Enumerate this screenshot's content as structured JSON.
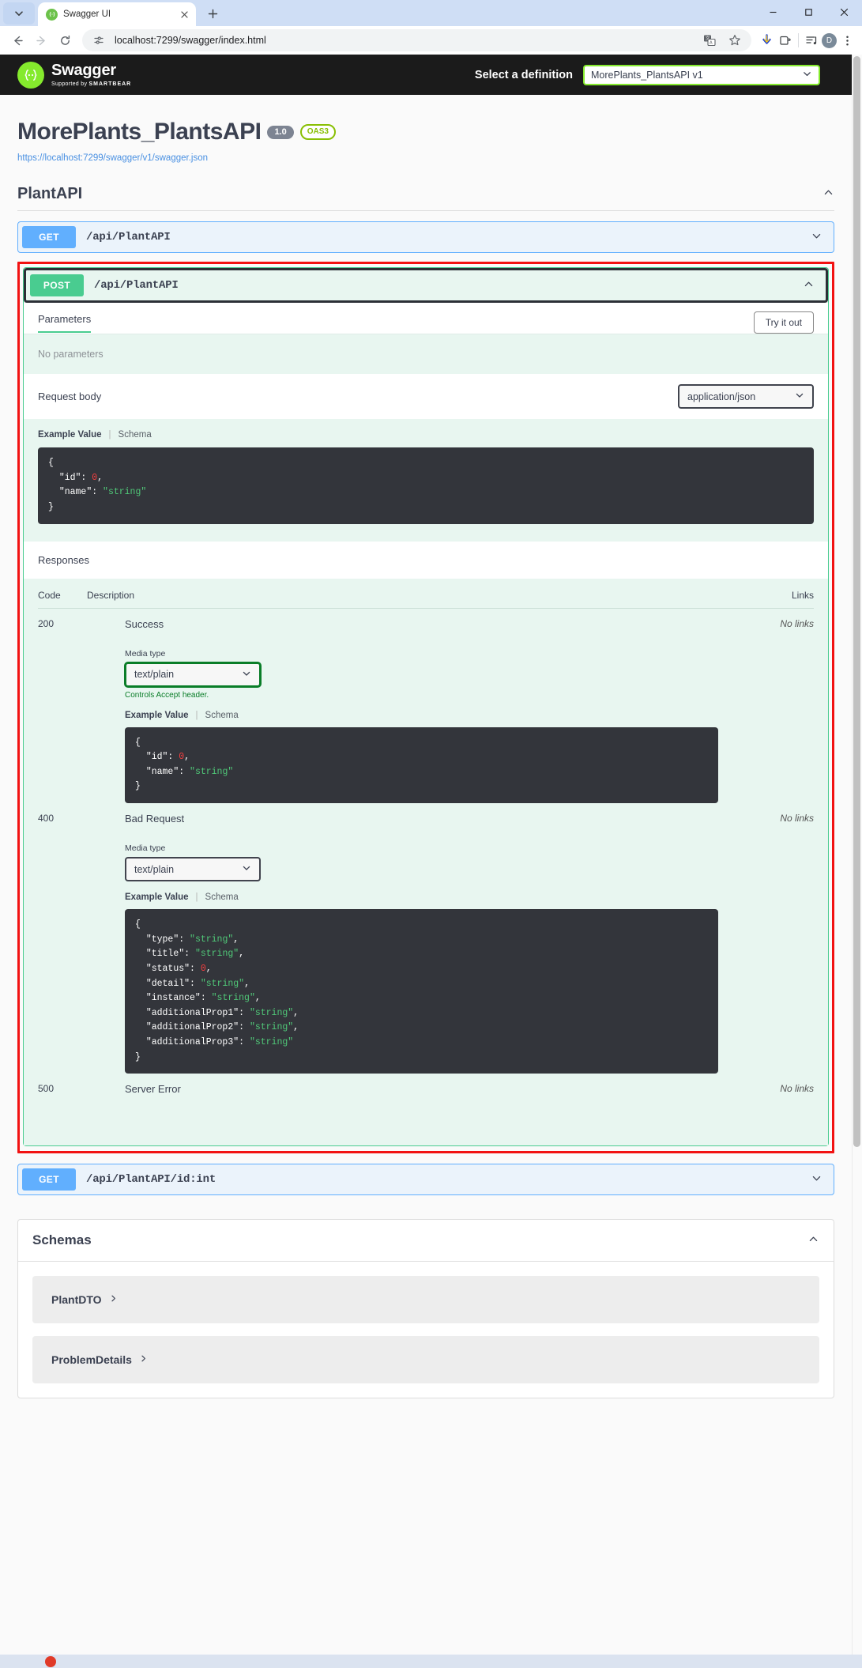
{
  "browser": {
    "tab": {
      "title": "Swagger UI",
      "favicon_icon": "swagger-favicon",
      "close_icon": "close-icon"
    },
    "tab_list_icon": "chevron-down-icon",
    "new_tab_icon": "plus-icon",
    "window_controls": {
      "minimize": "minimize-icon",
      "maximize": "maximize-icon",
      "close": "close-icon"
    },
    "nav": {
      "back_icon": "arrow-left-icon",
      "forward_icon": "arrow-right-icon",
      "reload_icon": "reload-icon"
    },
    "omnibox": {
      "site_info_icon": "site-settings-icon",
      "url": "localhost:7299/swagger/index.html",
      "translate_icon": "translate-icon",
      "bookmark_icon": "star-icon"
    },
    "toolbar_icons": {
      "download": "download-icon",
      "extensions": "extensions-icon",
      "media": "media-controls-icon",
      "profile_initial": "D",
      "menu": "three-dot-menu-icon"
    }
  },
  "swagger_topbar": {
    "logo_text": "Swagger",
    "logo_sub_prefix": "Supported by",
    "logo_sub_brand": "SMARTBEAR",
    "select_definition_label": "Select a definition",
    "definition_value": "MorePlants_PlantsAPI v1",
    "definition_caret_icon": "chevron-down-icon"
  },
  "api_info": {
    "title": "MorePlants_PlantsAPI",
    "version_badge": "1.0",
    "spec_badge": "OAS3",
    "spec_url": "https://localhost:7299/swagger/v1/swagger.json"
  },
  "tag_section": {
    "name": "PlantAPI",
    "collapse_icon": "chevron-up-icon"
  },
  "operations": [
    {
      "method": "GET",
      "path": "/api/PlantAPI",
      "expand_icon": "chevron-down-icon",
      "expanded": false
    },
    {
      "method": "POST",
      "path": "/api/PlantAPI",
      "expand_icon": "chevron-up-icon",
      "expanded": true
    },
    {
      "method": "GET",
      "path": "/api/PlantAPI/id:int",
      "expand_icon": "chevron-down-icon",
      "expanded": false
    }
  ],
  "post_operation": {
    "parameters_tab": "Parameters",
    "try_it_out_label": "Try it out",
    "no_parameters_text": "No parameters",
    "request_body_label": "Request body",
    "request_body_content_type": "application/json",
    "request_body_caret_icon": "chevron-down-icon",
    "example_tabs": {
      "example_value": "Example Value",
      "separator": "|",
      "schema": "Schema"
    },
    "request_example_json": [
      {
        "text": "{",
        "cls": "k"
      },
      {
        "text": "  \"id\": ",
        "cls": "k",
        "value": "0",
        "value_cls": "num",
        "suffix": ","
      },
      {
        "text": "  \"name\": ",
        "cls": "k",
        "value": "\"string\"",
        "value_cls": "str",
        "suffix": ""
      },
      {
        "text": "}",
        "cls": "k"
      }
    ],
    "responses_label": "Responses",
    "table_headers": {
      "code": "Code",
      "description": "Description",
      "links": "Links"
    },
    "responses": [
      {
        "code": "200",
        "description": "Success",
        "links": "No links",
        "media_type_label": "Media type",
        "media_type_value": "text/plain",
        "media_caret_icon": "chevron-down-icon",
        "accept_hint": "Controls Accept header.",
        "media_focused": true,
        "example_tabs": {
          "example_value": "Example Value",
          "schema": "Schema"
        },
        "example_json": "{\n  \"id\": 0,\n  \"name\": \"string\"\n}",
        "has_example": true
      },
      {
        "code": "400",
        "description": "Bad Request",
        "links": "No links",
        "media_type_label": "Media type",
        "media_type_value": "text/plain",
        "media_caret_icon": "chevron-down-icon",
        "accept_hint": "",
        "media_focused": false,
        "example_tabs": {
          "example_value": "Example Value",
          "schema": "Schema"
        },
        "example_json": "{\n  \"type\": \"string\",\n  \"title\": \"string\",\n  \"status\": 0,\n  \"detail\": \"string\",\n  \"instance\": \"string\",\n  \"additionalProp1\": \"string\",\n  \"additionalProp2\": \"string\",\n  \"additionalProp3\": \"string\"\n}",
        "has_example": true
      },
      {
        "code": "500",
        "description": "Server Error",
        "links": "No links",
        "has_example": false
      }
    ]
  },
  "schemas_section": {
    "title": "Schemas",
    "collapse_icon": "chevron-up-icon",
    "items": [
      {
        "name": "PlantDTO",
        "caret_icon": "chevron-right-icon"
      },
      {
        "name": "ProblemDetails",
        "caret_icon": "chevron-right-icon"
      }
    ]
  },
  "colors": {
    "get": "#61affe",
    "post": "#49cc90",
    "swagger_green": "#85ea2d",
    "topbar": "#1b1b1b",
    "highlight_red": "#f21212",
    "code_bg": "#33353b",
    "json_string": "#50c878",
    "json_number": "#f93e3e"
  }
}
